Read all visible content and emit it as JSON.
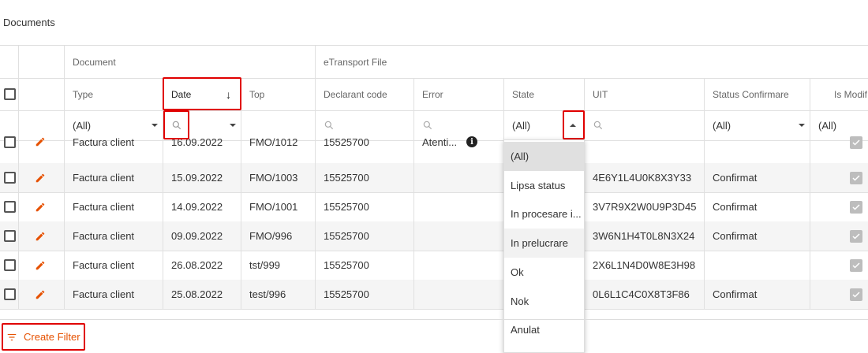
{
  "page": {
    "title": "Documents"
  },
  "groups": {
    "document": "Document",
    "etransport": "eTransport File"
  },
  "columns": {
    "type": "Type",
    "date": "Date",
    "top": "Top",
    "declarant": "Declarant code",
    "error": "Error",
    "state": "State",
    "uit": "UIT",
    "status": "Status Confirmare",
    "ismodif": "Is Modif"
  },
  "sort_indicator": "↓",
  "filters": {
    "type": "(All)",
    "state": "(All)",
    "status": "(All)",
    "ismodif": "(All)"
  },
  "rows": [
    {
      "type": "Factura client",
      "date": "16.09.2022",
      "top": "FMO/1012",
      "declarant": "15525700",
      "error": "Atenti...",
      "uit": "",
      "status": "",
      "checked": true
    },
    {
      "type": "Factura client",
      "date": "15.09.2022",
      "top": "FMO/1003",
      "declarant": "15525700",
      "error": "",
      "uit": "4E6Y1L4U0K8X3Y33",
      "status": "Confirmat",
      "checked": true
    },
    {
      "type": "Factura client",
      "date": "14.09.2022",
      "top": "FMO/1001",
      "declarant": "15525700",
      "error": "",
      "uit": "3V7R9X2W0U9P3D45",
      "status": "Confirmat",
      "checked": true
    },
    {
      "type": "Factura client",
      "date": "09.09.2022",
      "top": "FMO/996",
      "declarant": "15525700",
      "error": "",
      "uit": "3W6N1H4T0L8N3X24",
      "status": "Confirmat",
      "checked": true
    },
    {
      "type": "Factura client",
      "date": "26.08.2022",
      "top": "tst/999",
      "declarant": "15525700",
      "error": "",
      "uit": "2X6L1N4D0W8E3H98",
      "status": "",
      "checked": true
    },
    {
      "type": "Factura client",
      "date": "25.08.2022",
      "top": "test/996",
      "declarant": "15525700",
      "error": "",
      "uit": "0L6L1C4C0X8T3F86",
      "status": "Confirmat",
      "checked": true
    }
  ],
  "state_dropdown": [
    "(All)",
    "Lipsa status",
    "In procesare i...",
    "In prelucrare",
    "Ok",
    "Nok",
    "Anulat"
  ],
  "footer": {
    "create_filter": "Create Filter"
  },
  "colors": {
    "accent": "#e65100",
    "highlight_box": "#e00000",
    "row_alt": "#f5f5f5",
    "dropdown_selected": "#e0e0e0"
  }
}
